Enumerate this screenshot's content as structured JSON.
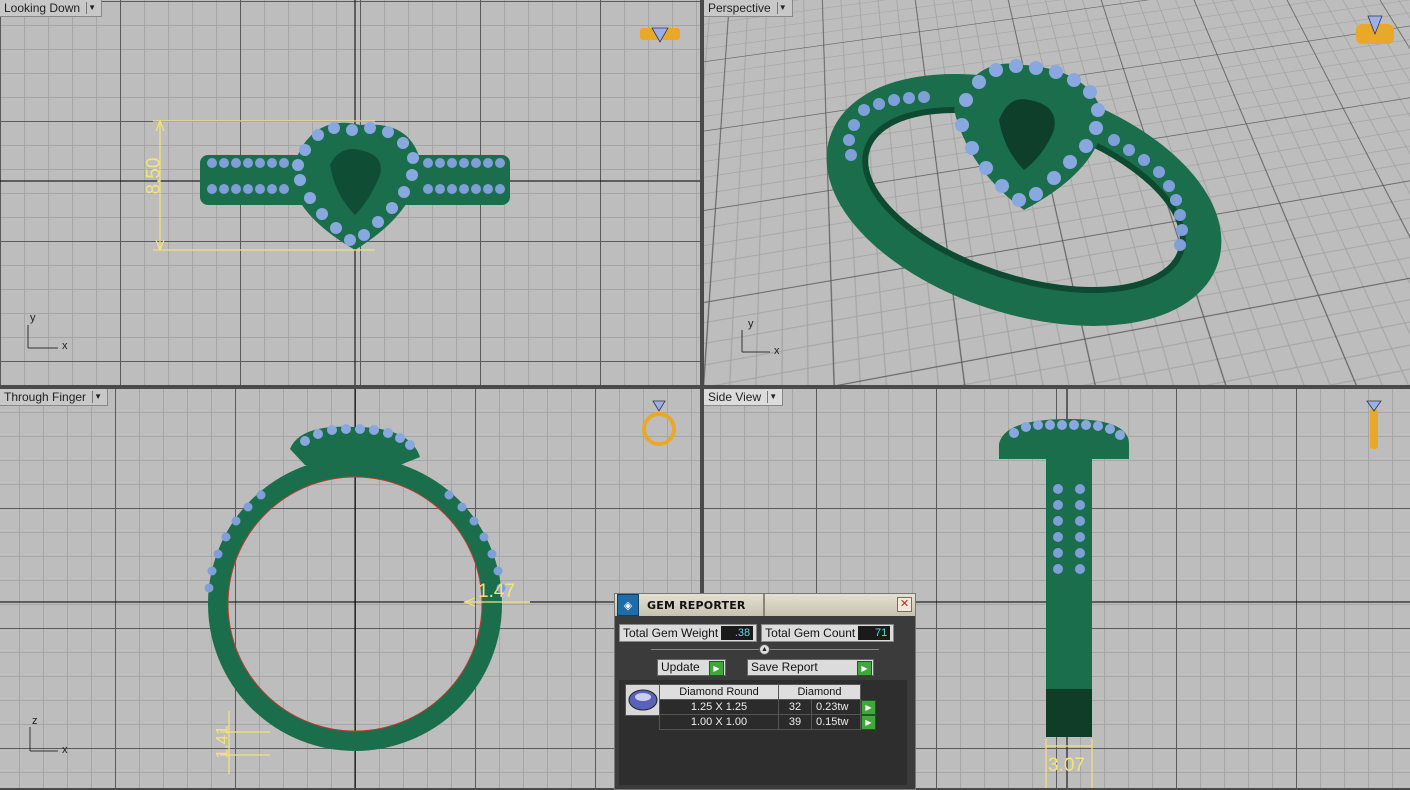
{
  "viewports": {
    "top": {
      "label": "Looking Down",
      "axis_x": "x",
      "axis_y": "y",
      "dimension": "8.50"
    },
    "perspective": {
      "label": "Perspective",
      "axis_x": "x",
      "axis_y": "y"
    },
    "front": {
      "label": "Through Finger",
      "axis_x": "x",
      "axis_y": "z",
      "dimension_thickness": "1.47",
      "dimension_height": "1.41"
    },
    "side": {
      "label": "Side View",
      "dimension": "3.07"
    }
  },
  "gem_reporter": {
    "title": "GEM REPORTER",
    "close_label": "✕",
    "total_weight_label": "Total Gem Weight",
    "total_weight_value": ".38",
    "total_count_label": "Total Gem Count",
    "total_count_value": "71",
    "update_label": "Update",
    "save_report_label": "Save Report",
    "table": {
      "headers": [
        "Diamond Round",
        "Diamond"
      ],
      "rows": [
        {
          "size": "1.25 X 1.25",
          "count": "32",
          "weight": "0.23tw"
        },
        {
          "size": "1.00 X 1.00",
          "count": "39",
          "weight": "0.15tw"
        }
      ]
    }
  },
  "colors": {
    "metal": "#1f7a55",
    "gem": "#7f9fd8",
    "dimension": "#f3e37a",
    "gizmo": "#e8a92a"
  }
}
